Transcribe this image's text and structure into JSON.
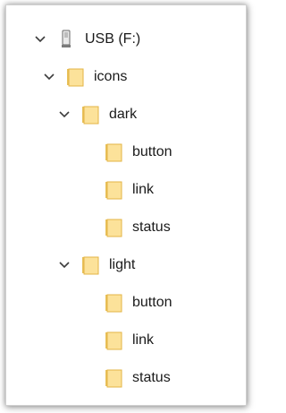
{
  "tree": {
    "drive": {
      "label": "USB (F:)",
      "icon": "usb-drive-icon",
      "expanded": true
    },
    "icons_folder": {
      "label": "icons",
      "icon": "folder-icon",
      "expanded": true
    },
    "dark_folder": {
      "label": "dark",
      "icon": "folder-icon",
      "expanded": true,
      "children": [
        {
          "label": "button",
          "icon": "folder-icon"
        },
        {
          "label": "link",
          "icon": "folder-icon"
        },
        {
          "label": "status",
          "icon": "folder-icon"
        }
      ]
    },
    "light_folder": {
      "label": "light",
      "icon": "folder-icon",
      "expanded": true,
      "children": [
        {
          "label": "button",
          "icon": "folder-icon"
        },
        {
          "label": "link",
          "icon": "folder-icon"
        },
        {
          "label": "status",
          "icon": "folder-icon"
        }
      ]
    }
  },
  "colors": {
    "folder_fill": "#FCE29A",
    "folder_edge": "#E3B446",
    "text": "#1A1A1A",
    "chevron": "#3C3C3C"
  }
}
